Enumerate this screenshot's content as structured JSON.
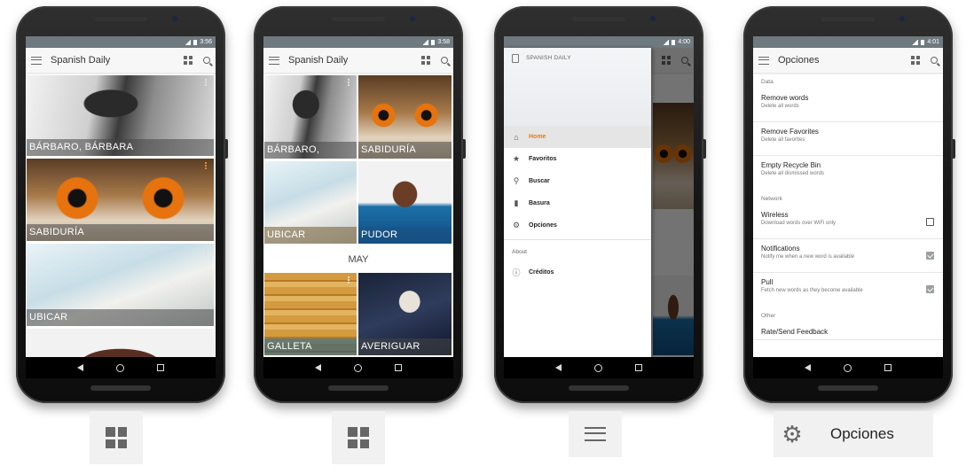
{
  "phones": [
    {
      "time": "3:56",
      "app_title": "Spanish Daily",
      "tiles": [
        "BÁRBARO, BÁRBARA",
        "SABIDURÍA",
        "UBICAR"
      ]
    },
    {
      "time": "3:58",
      "app_title": "Spanish Daily",
      "tiles": [
        "BÁRBARO,",
        "SABIDURÍA",
        "UBICAR",
        "PUDOR",
        "GALLETA",
        "AVERIGUAR"
      ],
      "section": "MAY"
    },
    {
      "time": "4:00",
      "drawer": {
        "app_name": "SPANISH DAILY",
        "items": [
          {
            "icon": "home-icon",
            "label": "Home"
          },
          {
            "icon": "star-icon",
            "label": "Favoritos"
          },
          {
            "icon": "search-icon",
            "label": "Buscar"
          },
          {
            "icon": "trash-icon",
            "label": "Basura"
          },
          {
            "icon": "gear-icon",
            "label": "Opciones"
          }
        ],
        "about_header": "About",
        "about_items": [
          {
            "icon": "info-icon",
            "label": "Créditos"
          }
        ]
      }
    },
    {
      "time": "4:01",
      "app_title": "Opciones",
      "categories": {
        "data": "Data",
        "network": "Network",
        "other": "Other"
      },
      "data_rows": [
        {
          "title": "Remove words",
          "summary": "Delete all words"
        },
        {
          "title": "Remove Favorites",
          "summary": "Delete all favorites"
        },
        {
          "title": "Empty Recycle Bin",
          "summary": "Delete all dismissed words"
        }
      ],
      "network_rows": [
        {
          "title": "Wireless",
          "summary": "Download words over WiFi only",
          "checked": false
        },
        {
          "title": "Notifications",
          "summary": "Notify me when a new word is available",
          "checked": true
        },
        {
          "title": "Pull",
          "summary": "Fetch new words as they become available",
          "checked": true
        }
      ],
      "other_rows": [
        {
          "title": "Rate/Send Feedback"
        }
      ]
    }
  ],
  "captions": {
    "fourth_label": "Opciones"
  },
  "colors": {
    "accent": "#e57b1a",
    "toolbar": "#f7f7f7",
    "statusbar": "#6f7a80"
  }
}
